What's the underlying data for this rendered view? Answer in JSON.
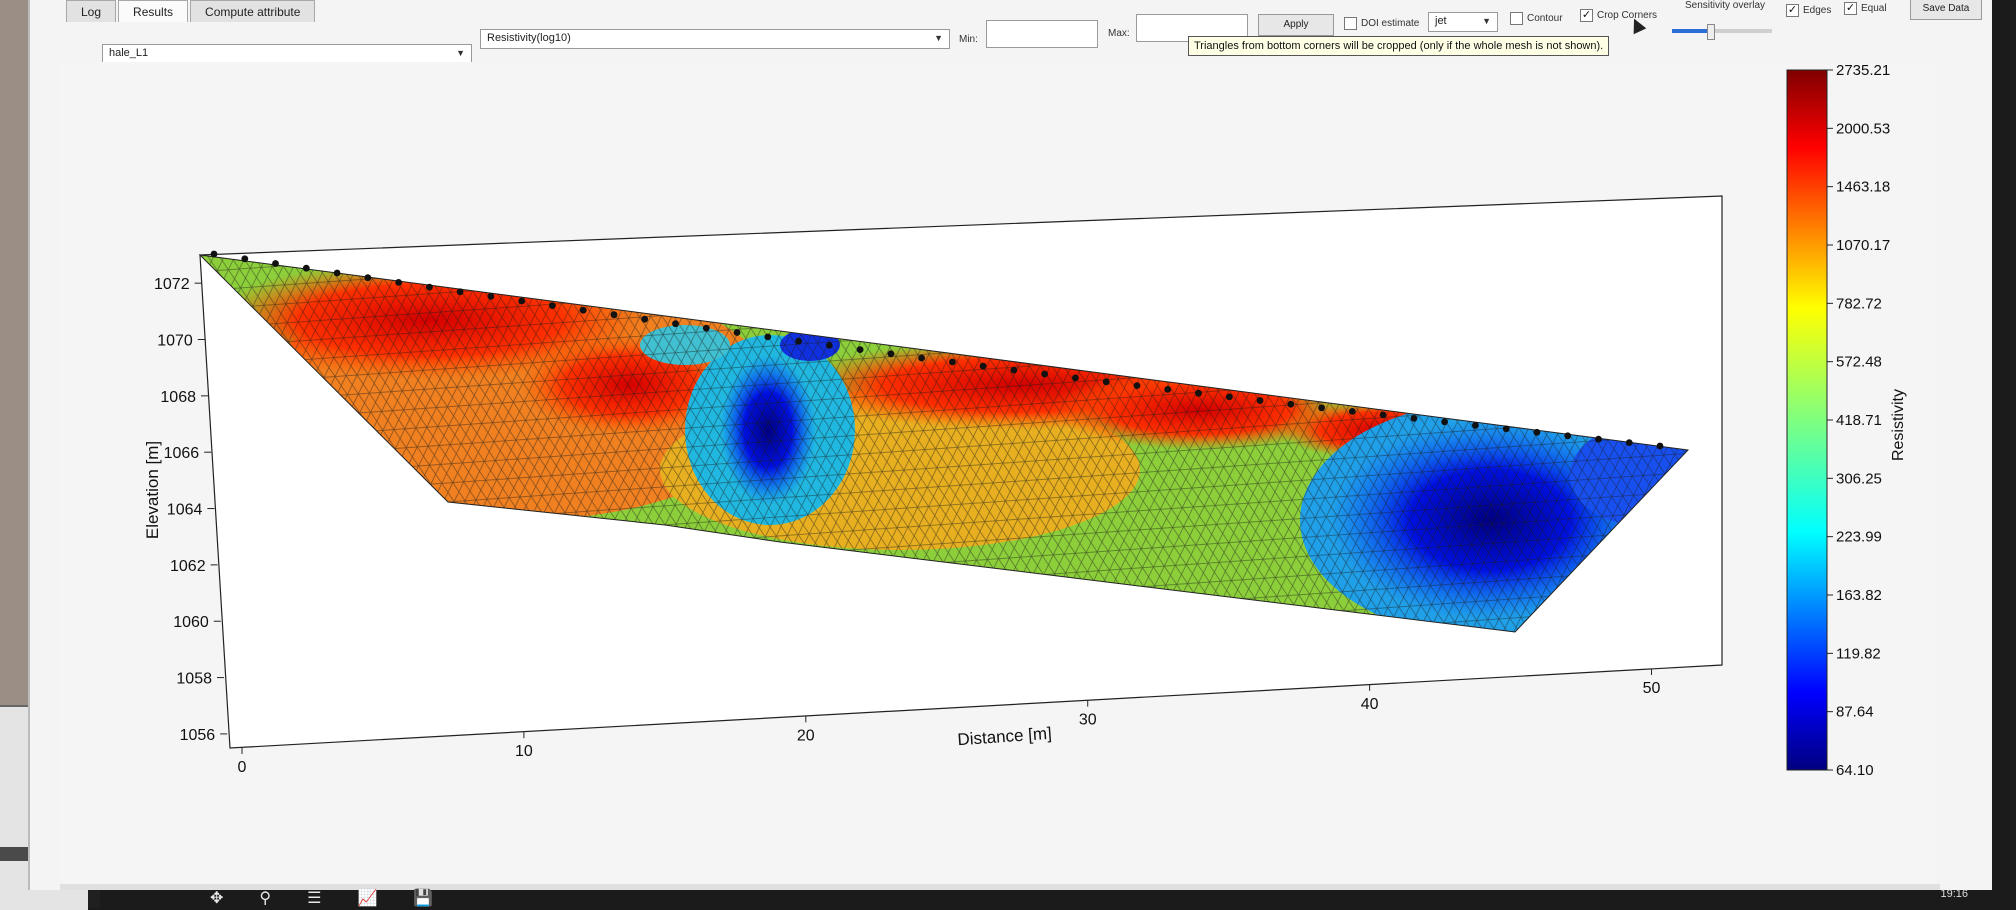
{
  "tabs": [
    "Log",
    "Results",
    "Compute attribute"
  ],
  "toolbar": {
    "profile_select": "hale_L1",
    "parameter_select": "Resistivity(log10)",
    "min_label": "Min:",
    "max_label": "Max:",
    "apply_label": "Apply",
    "doi_label": "DOI estimate",
    "colormap_select": "jet",
    "contour_label": "Contour",
    "crop_label": "Crop Corners",
    "sensitivity_label": "Sensitivity overlay",
    "edges_label": "Edges",
    "equal_label": "Equal",
    "save_label": "Save Data"
  },
  "checkboxes": {
    "doi": false,
    "contour": false,
    "crop_corners": true,
    "edges": true,
    "equal": true
  },
  "sensitivity_overlay_fraction": 0.38,
  "tooltip": "Triangles from bottom corners will be cropped (only if the whole mesh is not shown).",
  "chart_data": {
    "type": "heatmap",
    "xlabel": "Distance [m]",
    "ylabel": "Elevation [m]",
    "xticks": [
      0,
      10,
      20,
      30,
      40,
      50
    ],
    "yticks": [
      1072,
      1070,
      1068,
      1066,
      1064,
      1062,
      1060,
      1058,
      1056
    ],
    "xlim": [
      0,
      52.5
    ],
    "ylim": [
      1055.5,
      1073
    ],
    "colorbar": {
      "label": "Resistivity",
      "ticks": [
        "2735.21",
        "2000.53",
        "1463.18",
        "1070.17",
        "782.72",
        "572.48",
        "418.71",
        "306.25",
        "223.99",
        "163.82",
        "119.82",
        "87.64",
        "64.10"
      ],
      "colormap": "jet"
    }
  },
  "bottom_tools": [
    "move-icon",
    "zoom-icon",
    "configure-icon",
    "edit-curves-icon",
    "save-icon"
  ],
  "clock": "19:16"
}
